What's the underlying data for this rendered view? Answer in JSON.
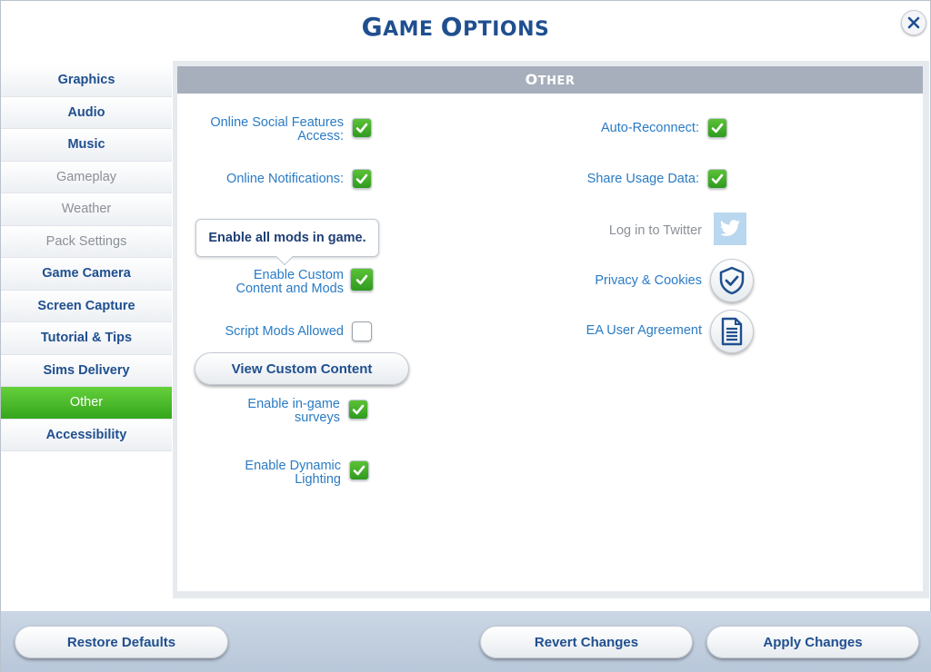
{
  "window": {
    "title_first_cap": "G",
    "title_first_rest": "AME ",
    "title_second_cap": "O",
    "title_second_rest": "PTIONS"
  },
  "sidebar": {
    "items": [
      {
        "label": "Graphics",
        "state": "normal"
      },
      {
        "label": "Audio",
        "state": "normal"
      },
      {
        "label": "Music",
        "state": "normal"
      },
      {
        "label": "Gameplay",
        "state": "dim"
      },
      {
        "label": "Weather",
        "state": "dim"
      },
      {
        "label": "Pack Settings",
        "state": "dim"
      },
      {
        "label": "Game Camera",
        "state": "normal"
      },
      {
        "label": "Screen Capture",
        "state": "normal"
      },
      {
        "label": "Tutorial & Tips",
        "state": "normal"
      },
      {
        "label": "Sims Delivery",
        "state": "normal"
      },
      {
        "label": "Other",
        "state": "active"
      },
      {
        "label": "Accessibility",
        "state": "normal"
      }
    ]
  },
  "section": {
    "header_cap": "O",
    "header_rest": "THER"
  },
  "left_options": {
    "online_social_line1": "Online Social Features",
    "online_social_line2": "Access:",
    "online_notifications": "Online Notifications:",
    "custom_content_line1": "Enable Custom",
    "custom_content_line2": "Content and Mods",
    "script_mods": "Script Mods Allowed",
    "surveys_line1": "Enable in-game",
    "surveys_line2": "surveys",
    "dynamic_lighting_line1": "Enable Dynamic",
    "dynamic_lighting_line2": "Lighting"
  },
  "tooltip": {
    "text": "Enable all mods in game."
  },
  "buttons": {
    "view_custom_content": "View Custom Content",
    "restore_defaults": "Restore Defaults",
    "revert_changes": "Revert Changes",
    "apply_changes": "Apply Changes"
  },
  "right_options": {
    "auto_reconnect": "Auto-Reconnect:",
    "share_usage_data": "Share Usage Data:",
    "twitter_login": "Log in to Twitter",
    "privacy_cookies": "Privacy & Cookies",
    "ea_user_agreement": "EA User Agreement"
  },
  "checkbox_states": {
    "online_social": true,
    "online_notifications": true,
    "custom_content": true,
    "script_mods": false,
    "surveys": true,
    "dynamic_lighting": true,
    "auto_reconnect": true,
    "share_usage_data": true
  },
  "colors": {
    "accent_blue": "#1f4f8f",
    "label_blue": "#2a7bc4",
    "active_green": "#4bbf2d",
    "header_gray": "#a6afbb"
  },
  "icons": {
    "close": "close-icon",
    "check": "checkmark-icon",
    "twitter": "twitter-bird-icon",
    "privacy": "shield-check-icon",
    "agreement": "document-icon"
  }
}
